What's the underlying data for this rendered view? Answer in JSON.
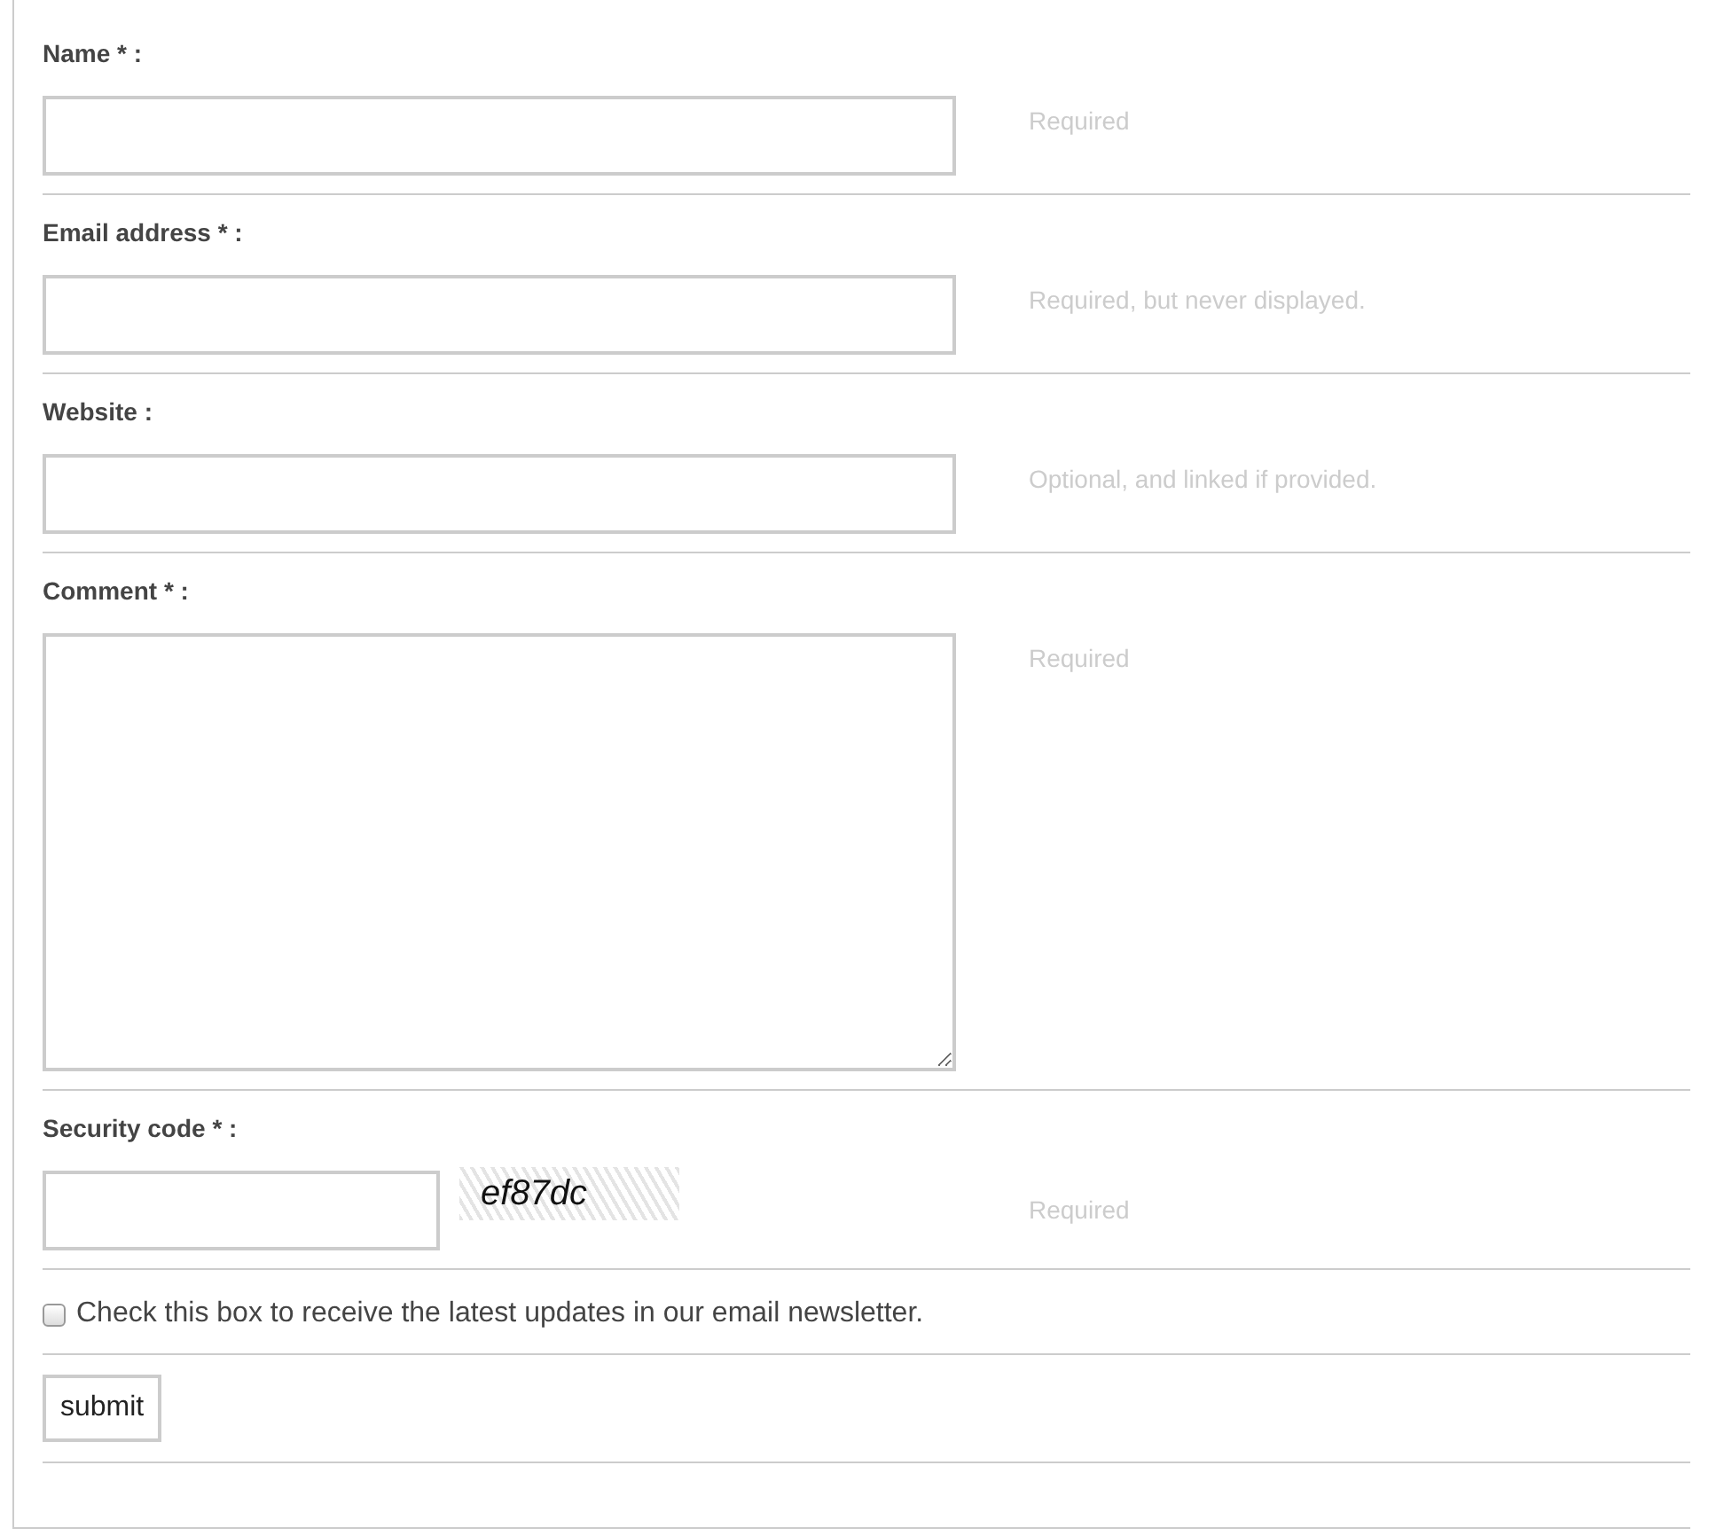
{
  "fields": [
    {
      "label": "Name * :",
      "kind": "input",
      "hint": "Required"
    },
    {
      "label": "Email address * :",
      "kind": "input",
      "hint": "Required, but never displayed."
    },
    {
      "label": "Website :",
      "kind": "input",
      "hint": "Optional, and linked if provided."
    },
    {
      "label": "Comment * :",
      "kind": "textarea",
      "hint": "Required"
    },
    {
      "label": "Security code * :",
      "kind": "captcha",
      "code": "ef87dc",
      "hint": "Required"
    }
  ],
  "newsletter": {
    "label": "Check this box to receive the latest updates in our email newsletter.",
    "checked": false
  },
  "submit": "submit"
}
